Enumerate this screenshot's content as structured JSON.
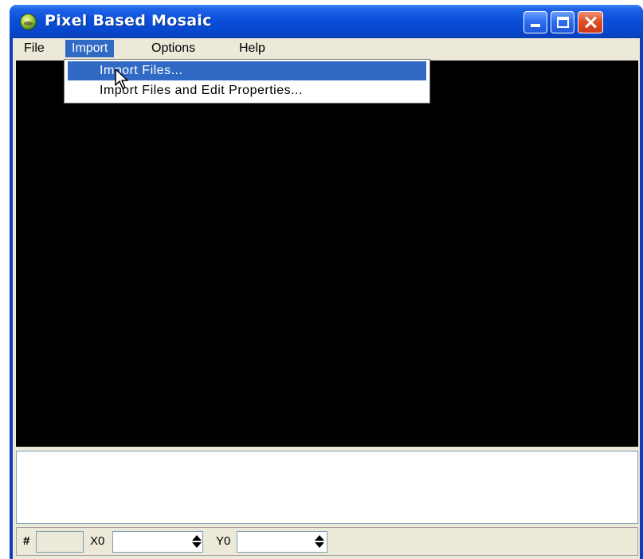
{
  "window": {
    "title": "Pixel Based Mosaic",
    "icon": "globe-app-icon",
    "controls": [
      "minimize-icon",
      "maximize-icon",
      "close-icon"
    ]
  },
  "menubar": {
    "items": [
      {
        "label": "File"
      },
      {
        "label": "Import",
        "active": true
      },
      {
        "label": "Options"
      },
      {
        "label": "Help"
      }
    ]
  },
  "import_menu": {
    "items": [
      {
        "label": "Import Files...",
        "highlighted": true
      },
      {
        "label": "Import Files and Edit Properties..."
      }
    ]
  },
  "statusbar": {
    "hash_label": "#",
    "hash_value": "",
    "x0_label": "X0",
    "x0_value": "",
    "y0_label": "Y0",
    "y0_value": ""
  },
  "colors": {
    "titlebar": "#0a4fd8",
    "highlight": "#316ac5",
    "canvas": "#000000",
    "face": "#ece9d8"
  }
}
